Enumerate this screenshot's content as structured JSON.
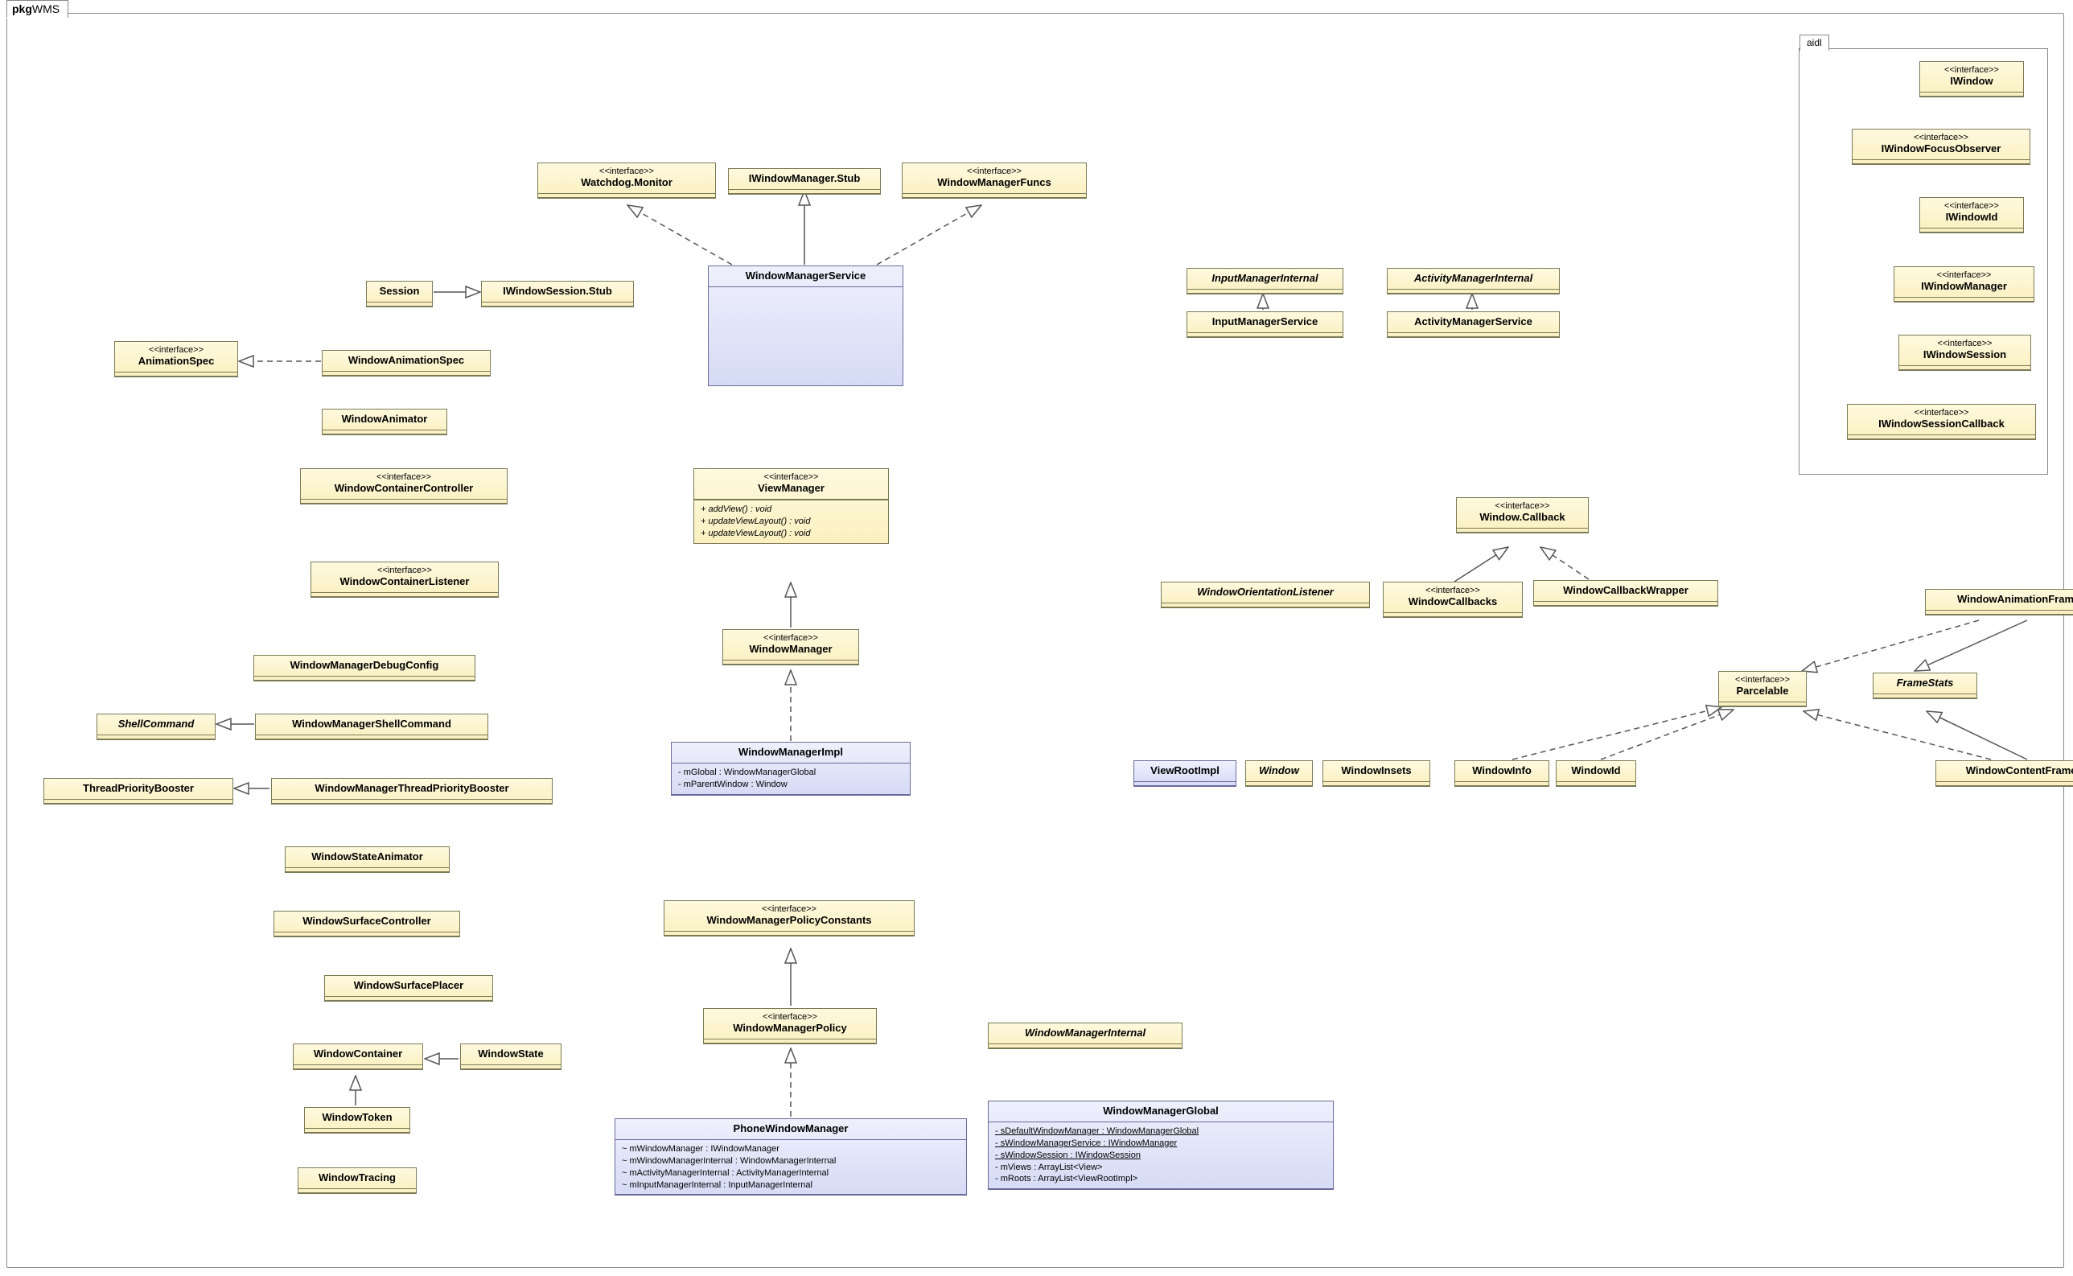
{
  "package_tab": {
    "prefix": "pkg",
    "name": "WMS"
  },
  "aidl_package": {
    "label": "aidl"
  },
  "classes": {
    "watchdog_monitor": {
      "stereotype": "<<interface>>",
      "name": "Watchdog.Monitor"
    },
    "iwm_stub": {
      "name": "IWindowManager.Stub"
    },
    "wm_funcs": {
      "stereotype": "<<interface>>",
      "name": "WindowManagerFuncs"
    },
    "wm_service": {
      "name": "WindowManagerService"
    },
    "session": {
      "name": "Session"
    },
    "iws_stub": {
      "name": "IWindowSession.Stub"
    },
    "animation_spec": {
      "stereotype": "<<interface>>",
      "name": "AnimationSpec"
    },
    "window_animation_spec": {
      "name": "WindowAnimationSpec"
    },
    "window_animator": {
      "name": "WindowAnimator"
    },
    "wcc": {
      "stereotype": "<<interface>>",
      "name": "WindowContainerController"
    },
    "wcl": {
      "stereotype": "<<interface>>",
      "name": "WindowContainerListener"
    },
    "wm_debug_config": {
      "name": "WindowManagerDebugConfig"
    },
    "shell_command": {
      "name": "ShellCommand",
      "italic": true
    },
    "wm_shell_command": {
      "name": "WindowManagerShellCommand"
    },
    "tp_booster": {
      "name": "ThreadPriorityBooster"
    },
    "wm_tp_booster": {
      "name": "WindowManagerThreadPriorityBooster"
    },
    "window_state_animator": {
      "name": "WindowStateAnimator"
    },
    "window_surface_ctrl": {
      "name": "WindowSurfaceController"
    },
    "window_surface_placer": {
      "name": "WindowSurfacePlacer"
    },
    "window_container": {
      "name": "WindowContainer"
    },
    "window_state": {
      "name": "WindowState"
    },
    "window_token": {
      "name": "WindowToken"
    },
    "window_tracing": {
      "name": "WindowTracing"
    },
    "view_manager": {
      "stereotype": "<<interface>>",
      "name": "ViewManager",
      "ops": [
        "+ addView() : void",
        "+ updateViewLayout() : void",
        "+ updateViewLayout() : void"
      ]
    },
    "window_manager": {
      "stereotype": "<<interface>>",
      "name": "WindowManager"
    },
    "window_manager_impl": {
      "name": "WindowManagerImpl",
      "attrs": [
        "- mGlobal : WindowManagerGlobal",
        "- mParentWindow : Window"
      ]
    },
    "wmp_constants": {
      "stereotype": "<<interface>>",
      "name": "WindowManagerPolicyConstants"
    },
    "wm_policy": {
      "stereotype": "<<interface>>",
      "name": "WindowManagerPolicy"
    },
    "phone_wm": {
      "name": "PhoneWindowManager",
      "attrs": [
        "~ mWindowManager : IWindowManager",
        "~ mWindowManagerInternal : WindowManagerInternal",
        "~ mActivityManagerInternal : ActivityManagerInternal",
        "~ mInputManagerInternal : InputManagerInternal"
      ]
    },
    "wm_internal": {
      "name": "WindowManagerInternal",
      "italic": true
    },
    "wm_global": {
      "name": "WindowManagerGlobal",
      "attrs_u": [
        "- sDefaultWindowManager : WindowManagerGlobal",
        "- sWindowManagerService : IWindowManager",
        "- sWindowSession : IWindowSession"
      ],
      "attrs": [
        "- mViews : ArrayList<View>",
        "- mRoots : ArrayList<ViewRootImpl>"
      ]
    },
    "input_mgr_internal": {
      "name": "InputManagerInternal",
      "italic": true
    },
    "input_mgr_service": {
      "name": "InputManagerService"
    },
    "activity_mgr_internal": {
      "name": "ActivityManagerInternal",
      "italic": true
    },
    "activity_mgr_service": {
      "name": "ActivityManagerService"
    },
    "window_callback": {
      "stereotype": "<<interface>>",
      "name": "Window.Callback"
    },
    "wol": {
      "name": "WindowOrientationListener",
      "italic": true
    },
    "window_callbacks": {
      "stereotype": "<<interface>>",
      "name": "WindowCallbacks"
    },
    "window_cb_wrapper": {
      "name": "WindowCallbackWrapper"
    },
    "parcelable": {
      "stereotype": "<<interface>>",
      "name": "Parcelable"
    },
    "wafs": {
      "name": "WindowAnimationFrameStats"
    },
    "frame_stats": {
      "name": "FrameStats",
      "italic": true
    },
    "wcfs": {
      "name": "WindowContentFrameStats"
    },
    "view_root_impl": {
      "name": "ViewRootImpl"
    },
    "window": {
      "name": "Window",
      "italic": true
    },
    "window_insets": {
      "name": "WindowInsets"
    },
    "window_info": {
      "name": "WindowInfo"
    },
    "window_id": {
      "name": "WindowId"
    },
    "iwindow": {
      "stereotype": "<<interface>>",
      "name": "IWindow"
    },
    "iwfo": {
      "stereotype": "<<interface>>",
      "name": "IWindowFocusObserver"
    },
    "iwindow_id": {
      "stereotype": "<<interface>>",
      "name": "IWindowId"
    },
    "iwindow_manager": {
      "stereotype": "<<interface>>",
      "name": "IWindowManager"
    },
    "iwindow_session": {
      "stereotype": "<<interface>>",
      "name": "IWindowSession"
    },
    "iwsc": {
      "stereotype": "<<interface>>",
      "name": "IWindowSessionCallback"
    }
  },
  "chart_data": {
    "type": "diagram",
    "diagram_kind": "uml_class",
    "package": "WMS",
    "edge_types": {
      "gen": "generalization (solid, hollow triangle)",
      "real": "realization (dashed, hollow triangle)"
    },
    "edges": [
      {
        "from": "WindowManagerService",
        "to": "Watchdog.Monitor",
        "type": "real"
      },
      {
        "from": "WindowManagerService",
        "to": "IWindowManager.Stub",
        "type": "gen"
      },
      {
        "from": "WindowManagerService",
        "to": "WindowManagerFuncs",
        "type": "real"
      },
      {
        "from": "Session",
        "to": "IWindowSession.Stub",
        "type": "gen"
      },
      {
        "from": "WindowAnimationSpec",
        "to": "AnimationSpec",
        "type": "real"
      },
      {
        "from": "WindowManagerShellCommand",
        "to": "ShellCommand",
        "type": "gen"
      },
      {
        "from": "WindowManagerThreadPriorityBooster",
        "to": "ThreadPriorityBooster",
        "type": "gen"
      },
      {
        "from": "WindowState",
        "to": "WindowContainer",
        "type": "gen"
      },
      {
        "from": "WindowToken",
        "to": "WindowContainer",
        "type": "gen"
      },
      {
        "from": "WindowManager",
        "to": "ViewManager",
        "type": "gen"
      },
      {
        "from": "WindowManagerImpl",
        "to": "WindowManager",
        "type": "real"
      },
      {
        "from": "WindowManagerPolicy",
        "to": "WindowManagerPolicyConstants",
        "type": "gen"
      },
      {
        "from": "PhoneWindowManager",
        "to": "WindowManagerPolicy",
        "type": "real"
      },
      {
        "from": "InputManagerService",
        "to": "InputManagerInternal",
        "type": "gen"
      },
      {
        "from": "ActivityManagerService",
        "to": "ActivityManagerInternal",
        "type": "gen"
      },
      {
        "from": "WindowCallbacks",
        "to": "Window.Callback",
        "type": "gen"
      },
      {
        "from": "WindowCallbackWrapper",
        "to": "Window.Callback",
        "type": "real"
      },
      {
        "from": "WindowInfo",
        "to": "Parcelable",
        "type": "real"
      },
      {
        "from": "WindowId",
        "to": "Parcelable",
        "type": "real"
      },
      {
        "from": "WindowAnimationFrameStats",
        "to": "Parcelable",
        "type": "real"
      },
      {
        "from": "WindowAnimationFrameStats",
        "to": "FrameStats",
        "type": "gen"
      },
      {
        "from": "WindowContentFrameStats",
        "to": "Parcelable",
        "type": "real"
      },
      {
        "from": "WindowContentFrameStats",
        "to": "FrameStats",
        "type": "gen"
      }
    ],
    "nested_packages": [
      {
        "name": "aidl",
        "classes": [
          "IWindow",
          "IWindowFocusObserver",
          "IWindowId",
          "IWindowManager",
          "IWindowSession",
          "IWindowSessionCallback"
        ]
      }
    ]
  }
}
